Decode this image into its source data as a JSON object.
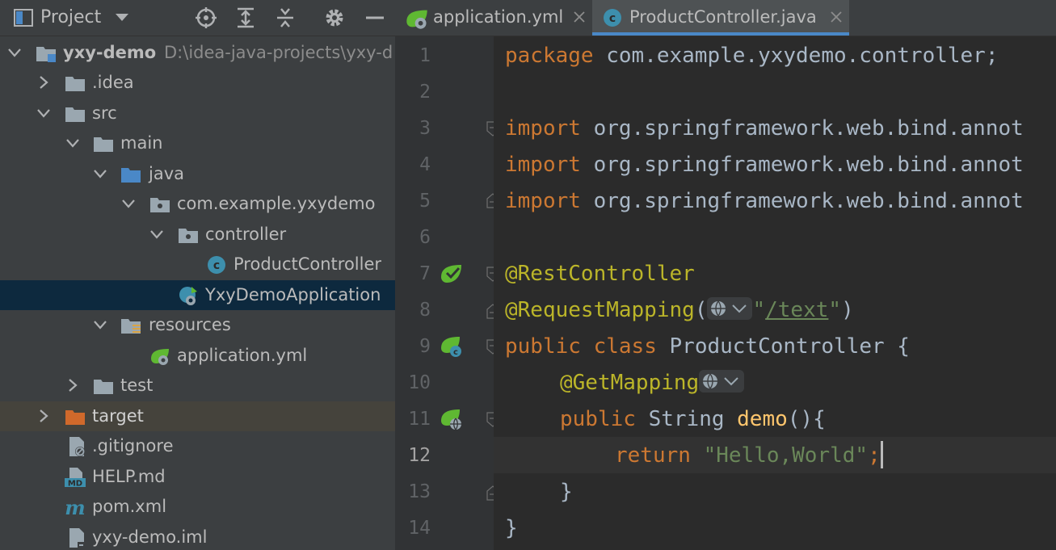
{
  "project_panel": {
    "title": "Project",
    "tree": [
      {
        "label": "yxy-demo",
        "hint": "D:\\idea-java-projects\\yxy-d",
        "icon": "module-folder-icon",
        "expanded": true
      },
      {
        "label": ".idea",
        "icon": "folder-icon",
        "expanded": false
      },
      {
        "label": "src",
        "icon": "folder-icon",
        "expanded": true
      },
      {
        "label": "main",
        "icon": "folder-icon",
        "expanded": true
      },
      {
        "label": "java",
        "icon": "source-folder-icon",
        "expanded": true
      },
      {
        "label": "com.example.yxydemo",
        "icon": "package-icon",
        "expanded": true
      },
      {
        "label": "controller",
        "icon": "package-icon",
        "expanded": true
      },
      {
        "label": "ProductController",
        "icon": "class-icon"
      },
      {
        "label": "YxyDemoApplication",
        "icon": "spring-boot-class-icon",
        "selected": true
      },
      {
        "label": "resources",
        "icon": "resources-folder-icon",
        "expanded": true
      },
      {
        "label": "application.yml",
        "icon": "spring-yml-icon"
      },
      {
        "label": "test",
        "icon": "folder-icon",
        "expanded": false
      },
      {
        "label": "target",
        "icon": "excluded-folder-icon",
        "expanded": false,
        "excluded": true
      },
      {
        "label": ".gitignore",
        "icon": "ignore-file-icon"
      },
      {
        "label": "HELP.md",
        "icon": "markdown-file-icon"
      },
      {
        "label": "pom.xml",
        "icon": "maven-icon"
      },
      {
        "label": "yxy-demo.iml",
        "icon": "iml-file-icon"
      }
    ]
  },
  "tabs": [
    {
      "label": "application.yml",
      "icon": "spring-yml-icon",
      "active": false
    },
    {
      "label": "ProductController.java",
      "icon": "class-icon",
      "active": true
    }
  ],
  "editor": {
    "line_numbers": [
      "1",
      "2",
      "3",
      "4",
      "5",
      "6",
      "7",
      "8",
      "9",
      "10",
      "11",
      "12",
      "13",
      "14"
    ],
    "current_line": "12",
    "lines": {
      "l1": {
        "kw": "package",
        "rest": " com.example.yxydemo.controller;"
      },
      "l3": {
        "kw": "import",
        "rest": " org.springframework.web.bind.annot"
      },
      "l4": {
        "kw": "import",
        "rest": " org.springframework.web.bind.annot"
      },
      "l5": {
        "kw": "import",
        "rest": " org.springframework.web.bind.annot"
      },
      "l7": {
        "ann": "@RestController"
      },
      "l8": {
        "ann": "@RequestMapping",
        "open": "(",
        "str_q1": "\"",
        "str": "/text",
        "str_q2": "\"",
        "close": ")"
      },
      "l9": {
        "kw1": "public",
        "kw2": "class",
        "name": " ProductController {"
      },
      "l10": {
        "ann": "@GetMapping"
      },
      "l11": {
        "kw": "public",
        "type": " String ",
        "fn": "demo",
        "rest": "(){"
      },
      "l12": {
        "kw": "return",
        "str": "\"Hello,World\"",
        "semi": ";"
      },
      "l13": {
        "rest": "}"
      },
      "l14": {
        "rest": "}"
      }
    }
  },
  "colors": {
    "keyword": "#cc7832",
    "annotation": "#bbb529",
    "string": "#6a8759",
    "function": "#ffc66d",
    "text": "#a9b7c6",
    "selection": "#0d293e",
    "tab_underline": "#4a88c7"
  }
}
